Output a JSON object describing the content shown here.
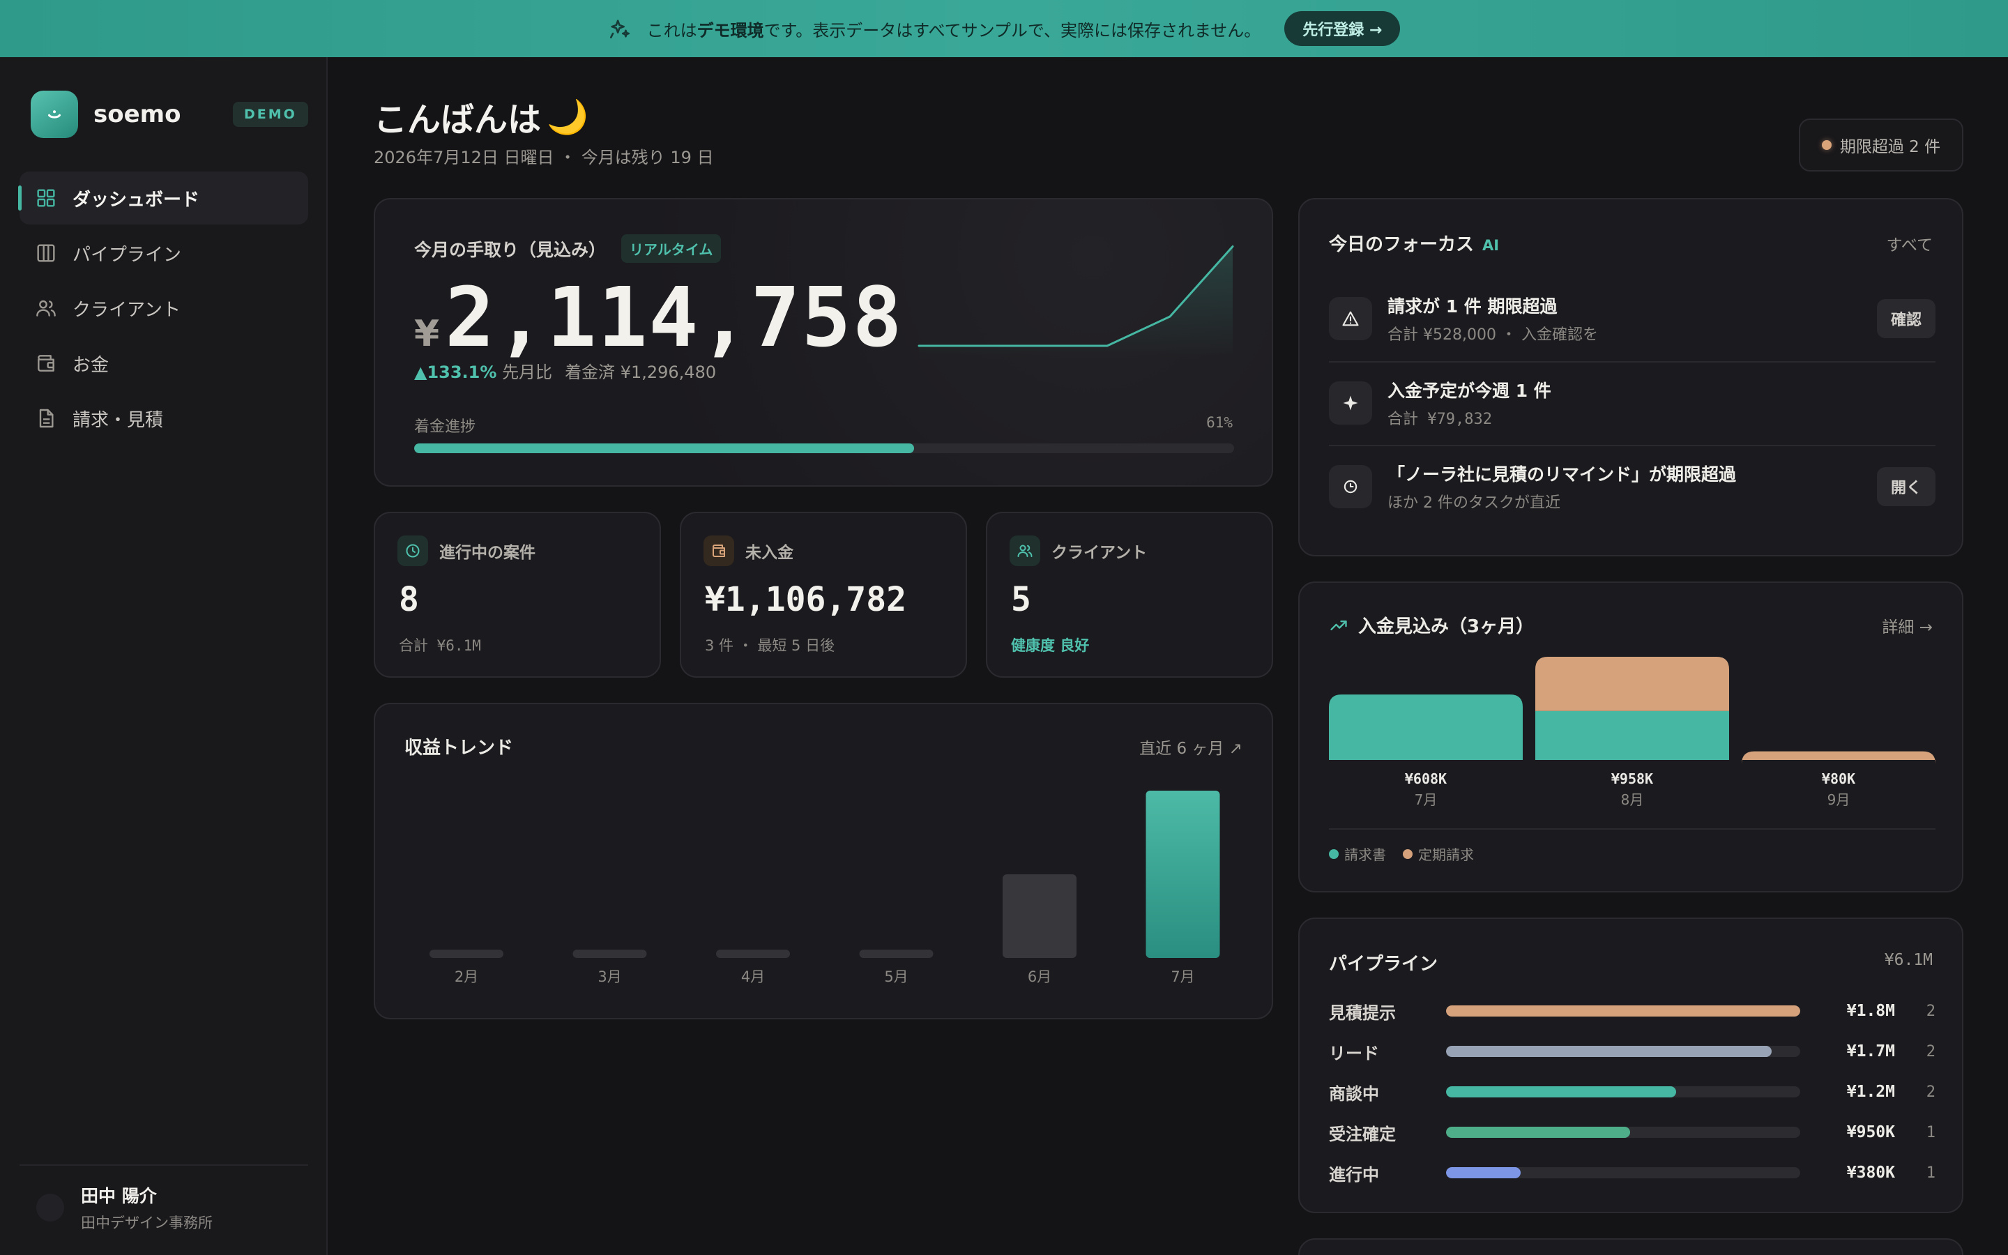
{
  "banner": {
    "message_pre": "これは",
    "message_bold": "デモ環境",
    "message_post": "です。表示データはすべてサンプルで、実際には保存されません。",
    "cta": "先行登録 →"
  },
  "brand": {
    "name": "soemo",
    "badge": "DEMO"
  },
  "sidebar": {
    "items": [
      {
        "label": "ダッシュボード",
        "icon": "grid-icon",
        "active": true
      },
      {
        "label": "パイプライン",
        "icon": "columns-icon",
        "active": false
      },
      {
        "label": "クライアント",
        "icon": "users-icon",
        "active": false
      },
      {
        "label": "お金",
        "icon": "wallet-icon",
        "active": false
      },
      {
        "label": "請求・見積",
        "icon": "document-icon",
        "active": false
      }
    ]
  },
  "user": {
    "name": "田中 陽介",
    "org": "田中デザイン事務所"
  },
  "header": {
    "greeting": "こんばんは",
    "greeting_emoji": "🌙",
    "date": "2026年7月12日 日曜日 ・ 今月は残り 19 日",
    "overdue_chip": "期限超過 2 件"
  },
  "hero": {
    "label": "今月の手取り（見込み）",
    "badge": "リアルタイム",
    "currency": "¥",
    "amount": "2,114,758",
    "change": "▲133.1%",
    "change_label": "先月比",
    "received": "着金済 ¥1,296,480",
    "progress_label": "着金進捗",
    "progress_text": "61%",
    "progress_value": 0.61,
    "sparkline": [
      0,
      0,
      0,
      0,
      0.28,
      0.95
    ]
  },
  "stats": [
    {
      "label": "進行中の案件",
      "value": "8",
      "sub": "合計 ¥6.1M",
      "icon": "clock-icon",
      "tone": "teal"
    },
    {
      "label": "未入金",
      "value": "¥1,106,782",
      "sub": "3 件 ・ 最短 5 日後",
      "icon": "wallet-icon",
      "tone": "orange"
    },
    {
      "label": "クライアント",
      "value": "5",
      "sub": "健康度 良好",
      "icon": "users-icon",
      "tone": "teal"
    }
  ],
  "trend": {
    "title": "収益トレンド",
    "range": "直近 6 ヶ月 ↗"
  },
  "chart_data": [
    {
      "type": "bar",
      "title": "収益トレンド",
      "categories": [
        "2月",
        "3月",
        "4月",
        "5月",
        "6月",
        "7月"
      ],
      "values": [
        0.05,
        0.05,
        0.05,
        0.05,
        0.5,
        1.0
      ],
      "highlight_index": 5
    },
    {
      "type": "bar",
      "title": "入金見込み（3ヶ月）",
      "categories": [
        "7月",
        "8月",
        "9月"
      ],
      "value_labels": [
        "¥608K",
        "¥958K",
        "¥80K"
      ],
      "series": [
        {
          "name": "請求書",
          "color": "#45b7a3",
          "values": [
            608,
            455,
            0
          ]
        },
        {
          "name": "定期請求",
          "color": "#d5a27c",
          "values": [
            0,
            503,
            80
          ]
        }
      ]
    }
  ],
  "focus": {
    "title": "今日のフォーカス",
    "ai": "AI",
    "all": "すべて",
    "items": [
      {
        "title": "請求が 1 件 期限超過",
        "sub": "合計 ¥528,000 ・ 入金確認を",
        "icon": "warning-icon",
        "action": "確認"
      },
      {
        "title": "入金予定が今週 1 件",
        "sub": "合計 ¥79,832",
        "icon": "sparkle-icon",
        "action": ""
      },
      {
        "title": "「ノーラ社に見積のリマインド」が期限超過",
        "sub": "ほか 2 件のタスクが直近",
        "icon": "clock-icon",
        "action": "開く"
      }
    ]
  },
  "forecast": {
    "title": "入金見込み（3ヶ月）",
    "detail": "詳細 →"
  },
  "pipeline": {
    "title": "パイプライン",
    "total": "¥6.1M",
    "rows": [
      {
        "name": "見積提示",
        "amount": "¥1.8M",
        "count": "2",
        "fraction": 1.0,
        "color": "#d5a27c"
      },
      {
        "name": "リード",
        "amount": "¥1.7M",
        "count": "2",
        "fraction": 0.92,
        "color": "#98a3b6"
      },
      {
        "name": "商談中",
        "amount": "¥1.2M",
        "count": "2",
        "fraction": 0.65,
        "color": "#45b7a3"
      },
      {
        "name": "受注確定",
        "amount": "¥950K",
        "count": "1",
        "fraction": 0.52,
        "color": "#4fae8a"
      },
      {
        "name": "進行中",
        "amount": "¥380K",
        "count": "1",
        "fraction": 0.21,
        "color": "#7d96e6"
      }
    ]
  }
}
